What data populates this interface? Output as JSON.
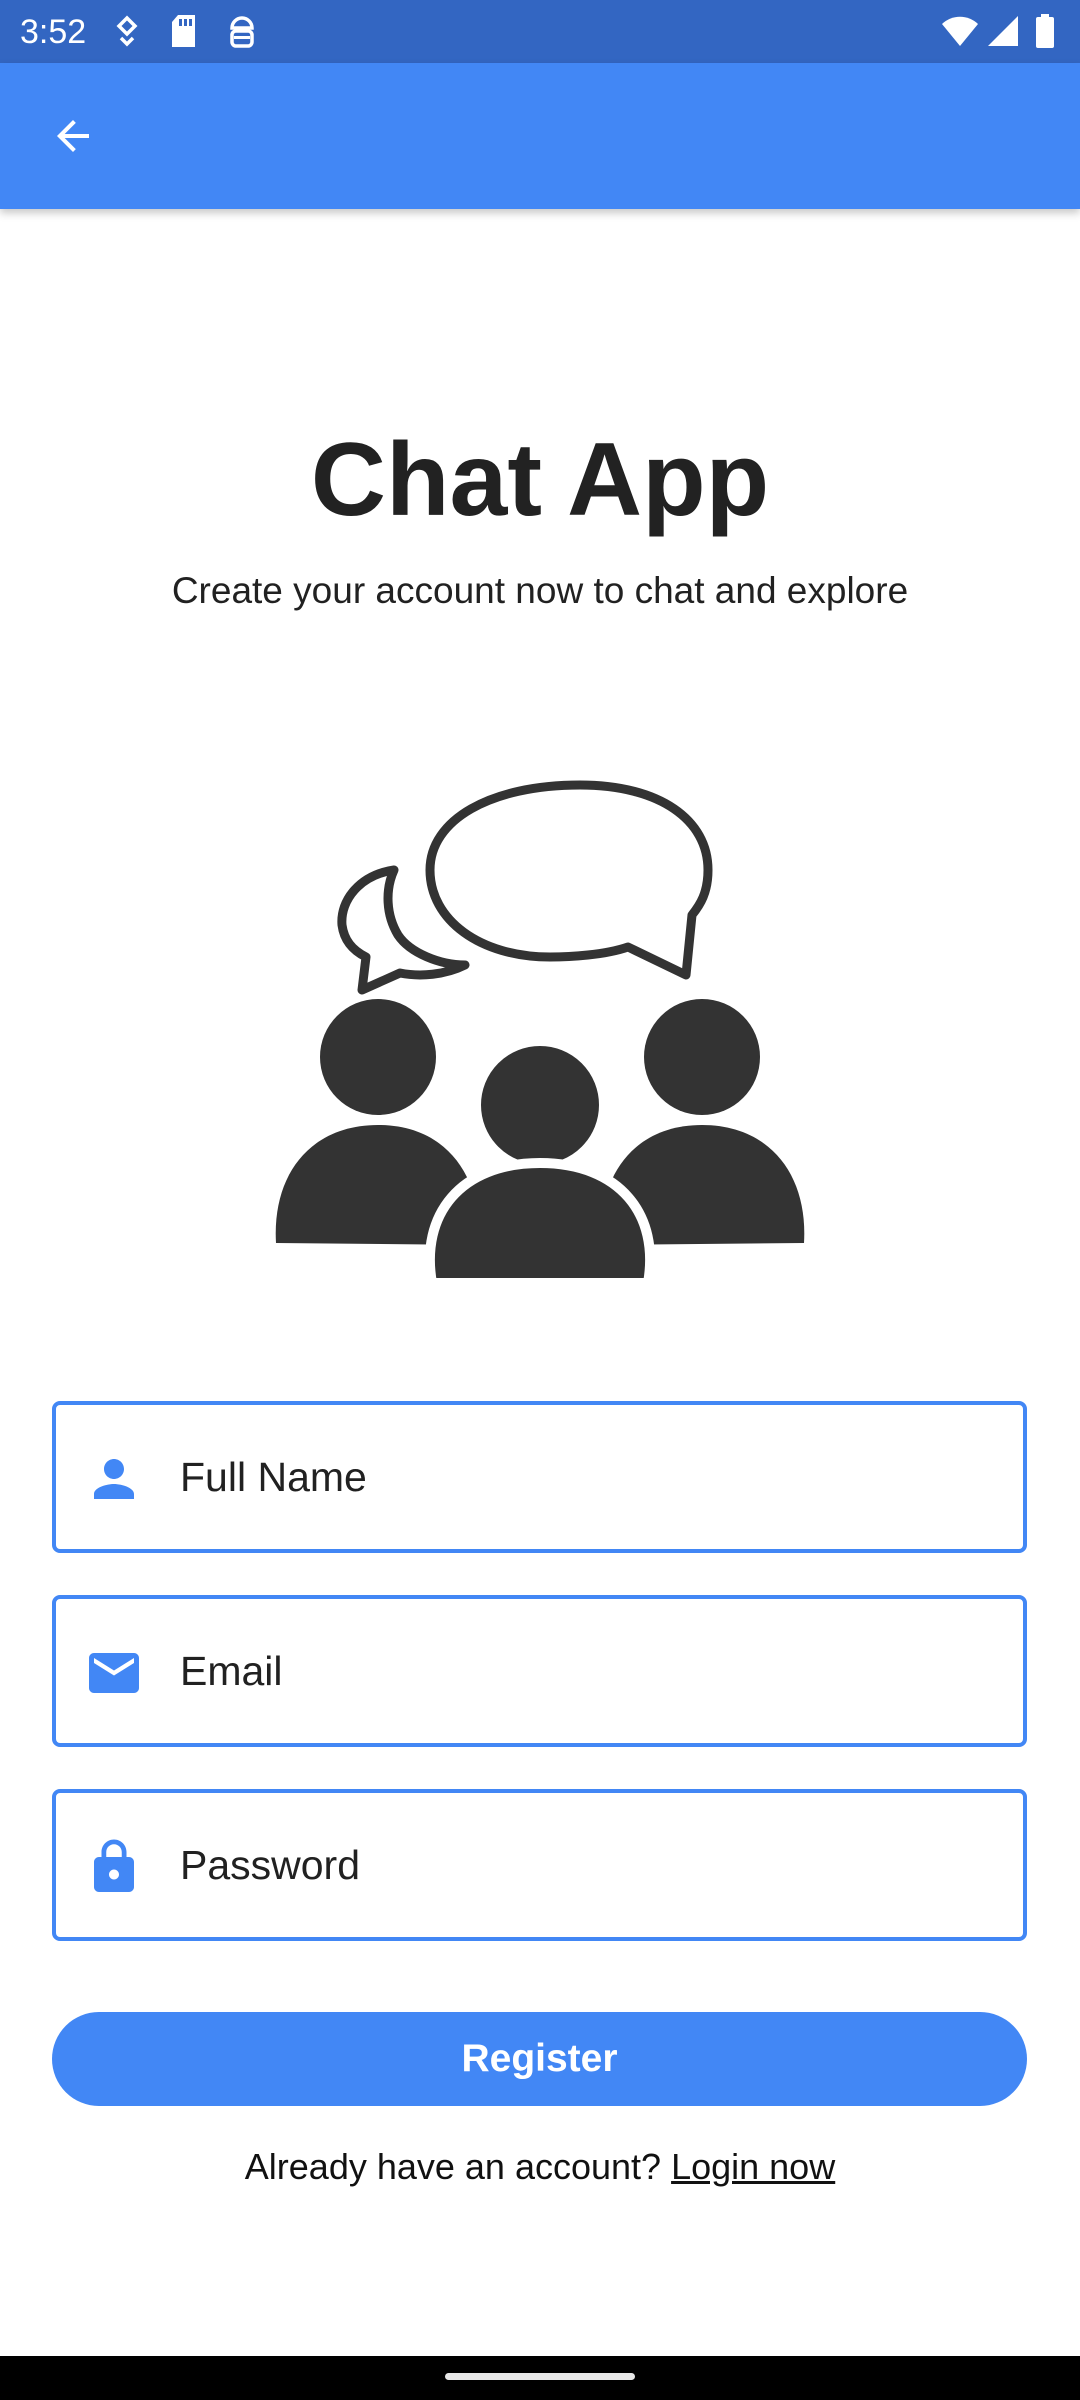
{
  "status_bar": {
    "time": "3:52",
    "left_icons": [
      "data-saver-icon",
      "sd-card-icon",
      "android-debug-icon"
    ],
    "right_icons": [
      "wifi-icon",
      "cell-signal-icon",
      "battery-icon"
    ]
  },
  "app_bar": {
    "back_icon": "arrow-back-icon",
    "color": "#4287f5"
  },
  "header": {
    "title": "Chat App",
    "subtitle": "Create your account now to chat and explore"
  },
  "hero": {
    "icon": "group-chat-icon"
  },
  "form": {
    "full_name": {
      "placeholder": "Full Name",
      "value": "",
      "icon": "person-icon"
    },
    "email": {
      "placeholder": "Email",
      "value": "",
      "icon": "mail-icon"
    },
    "password": {
      "placeholder": "Password",
      "value": "",
      "icon": "lock-icon"
    },
    "register_label": "Register"
  },
  "footer": {
    "prompt": "Already have an account? ",
    "login_label": "Login now"
  },
  "colors": {
    "status_bar": "#3366c2",
    "accent": "#4287f5",
    "text": "#212121",
    "illustration": "#333333"
  }
}
